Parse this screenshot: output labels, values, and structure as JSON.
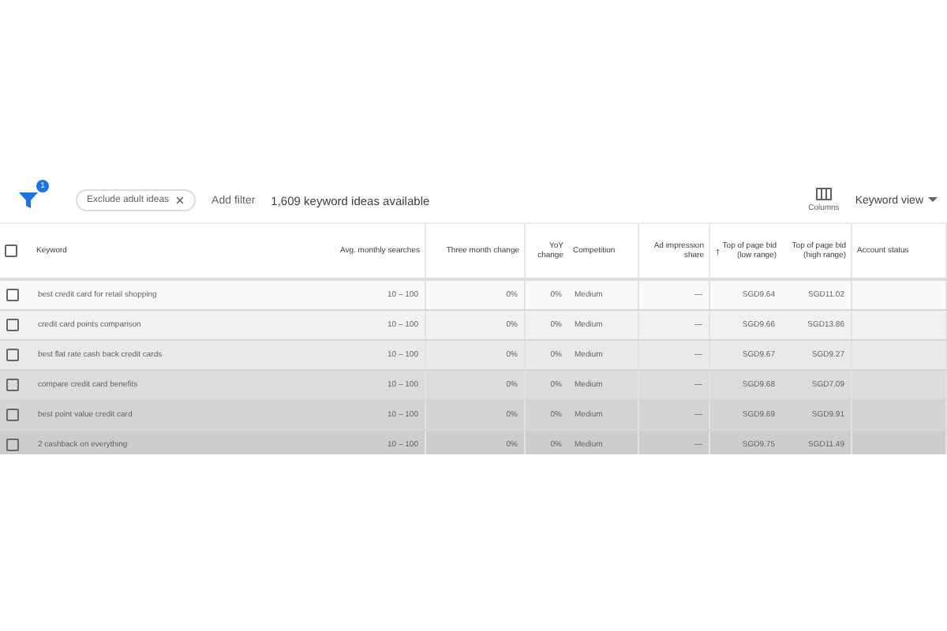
{
  "toolbar": {
    "filter_badge": "1",
    "chip": "Exclude adult ideas",
    "add_filter": "Add filter",
    "summary": "1,609 keyword ideas available",
    "columns_label": "Columns",
    "view_menu": "Keyword view"
  },
  "table": {
    "all_checked": false,
    "columns": [
      "Keyword",
      "Avg. monthly searches",
      "Three month change",
      "YoY change",
      "Competition",
      "Ad impression share",
      "Top of page bid (low range)",
      "Top of page bid (high range)",
      "Account status"
    ],
    "rows": [
      {
        "checked": false,
        "cells": [
          "best credit card for retail shopping",
          "10 – 100",
          "0%",
          "0%",
          "Medium",
          "—",
          "SGD9.64",
          "SGD11.02",
          ""
        ]
      },
      {
        "checked": false,
        "cells": [
          "credit card points comparison",
          "10 – 100",
          "0%",
          "0%",
          "Medium",
          "—",
          "SGD9.66",
          "SGD13.86",
          ""
        ]
      },
      {
        "checked": false,
        "cells": [
          "best flat rate cash back credit cards",
          "10 – 100",
          "0%",
          "0%",
          "Medium",
          "—",
          "SGD9.67",
          "SGD9.27",
          ""
        ]
      },
      {
        "checked": false,
        "cells": [
          "compare credit card benefits",
          "10 – 100",
          "0%",
          "0%",
          "Medium",
          "—",
          "SGD9.68",
          "SGD7.09",
          ""
        ]
      },
      {
        "checked": false,
        "cells": [
          "best point value credit card",
          "10 – 100",
          "0%",
          "0%",
          "Medium",
          "—",
          "SGD9.69",
          "SGD9.91",
          ""
        ]
      },
      {
        "checked": false,
        "cells": [
          "2 cashback on everything",
          "10 – 100",
          "0%",
          "0%",
          "Medium",
          "—",
          "SGD9.75",
          "SGD11.49",
          ""
        ]
      }
    ]
  }
}
